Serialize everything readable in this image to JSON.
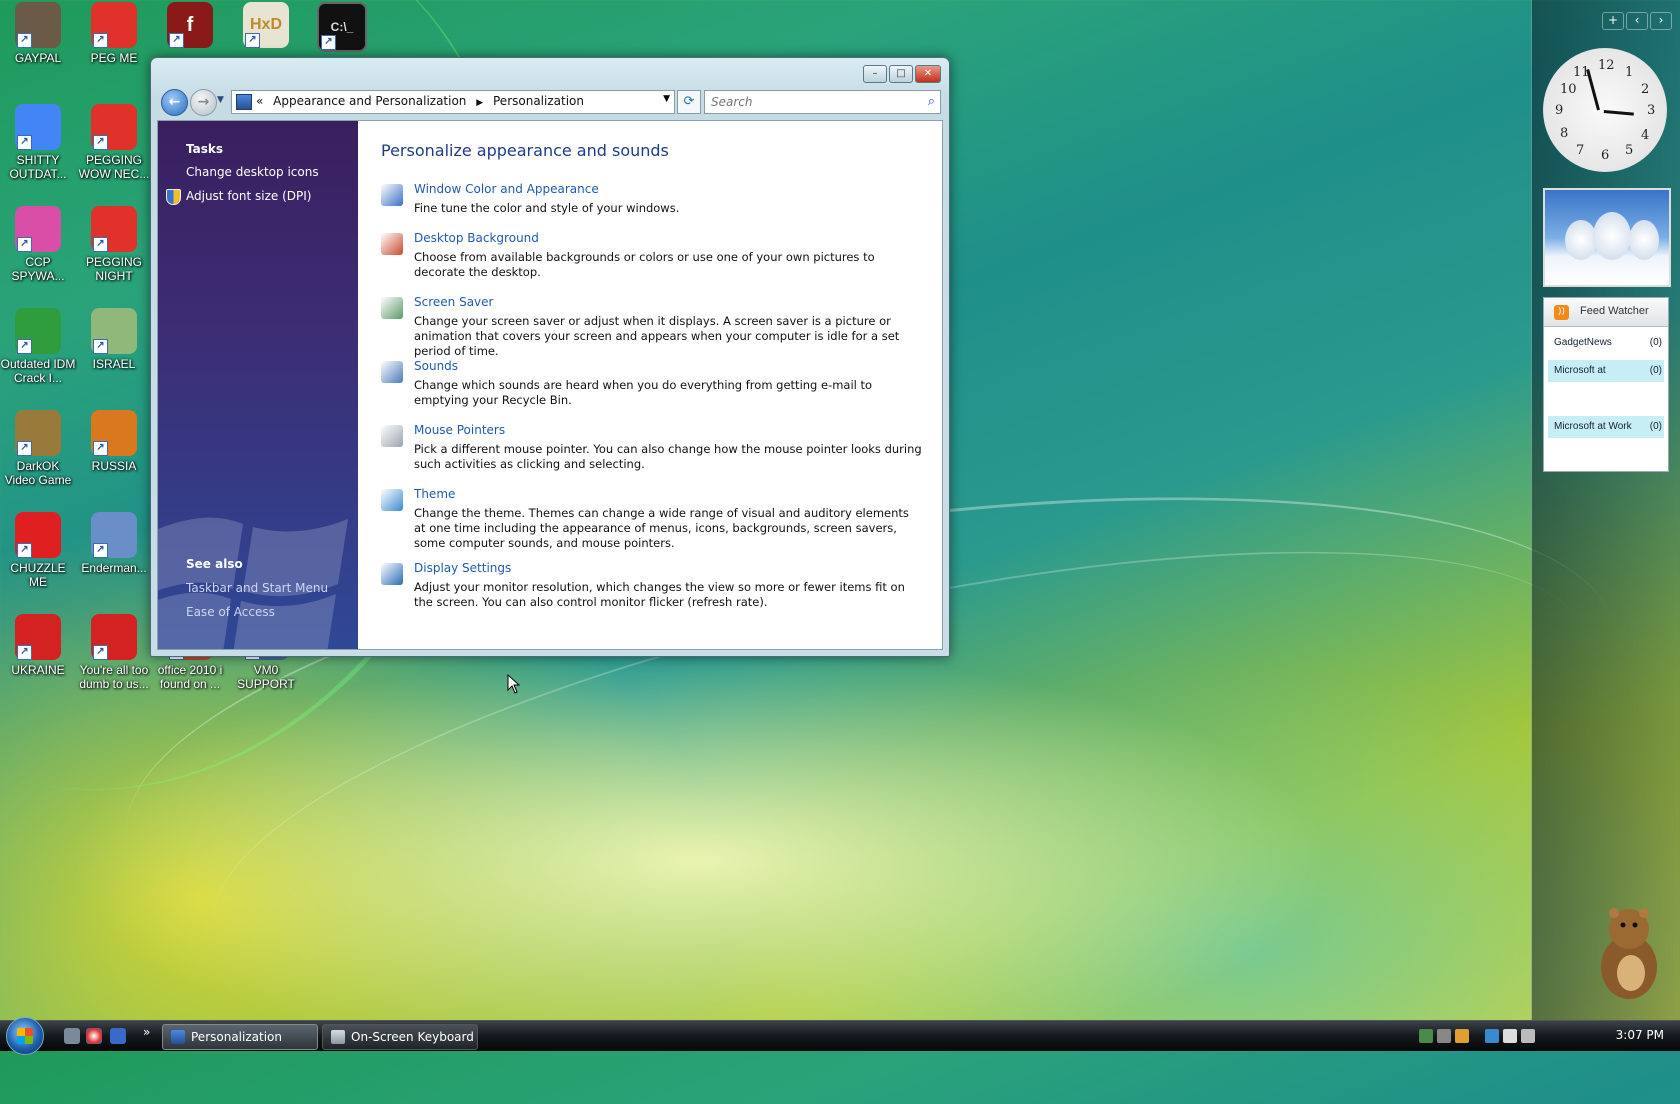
{
  "desktop": {
    "icons": [
      {
        "label": "GAYPAL",
        "color": "#6b5a45"
      },
      {
        "label": "PEG ME",
        "color": "#e0322a"
      },
      {
        "label": "SHITTY OUTDAT...",
        "color": "#4285f4"
      },
      {
        "label": "PEGGING WOW NEC...",
        "color": "#e0322a"
      },
      {
        "label": "CCP SPYWA...",
        "color": "#d94fa8"
      },
      {
        "label": "PEGGING NIGHT",
        "color": "#e0322a"
      },
      {
        "label": "Outdated IDM Crack I...",
        "color": "#2f9c3e"
      },
      {
        "label": "ISRAEL",
        "color": "#8fb87a"
      },
      {
        "label": "DarkOK Video Game",
        "color": "#9a7a3a"
      },
      {
        "label": "RUSSIA",
        "color": "#d9781e"
      },
      {
        "label": "CHUZZLE ME",
        "color": "#e02020"
      },
      {
        "label": "Enderman...",
        "color": "#6a8ec8"
      },
      {
        "label": "UKRAINE",
        "color": "#d42222"
      },
      {
        "label": "You're all too dumb to us...",
        "color": "#d42222"
      },
      {
        "label": "office 2010 i found on ...",
        "color": "#c84a2a"
      },
      {
        "label": "VM0 SUPPORT",
        "color": "#4a6a9a"
      }
    ],
    "top_icons": [
      "flash-icon",
      "hxd-icon",
      "cmd-icon"
    ]
  },
  "window": {
    "address": {
      "overflow": "«",
      "crumbs": [
        "Appearance and Personalization",
        "Personalization"
      ]
    },
    "search_placeholder": "Search",
    "left_pane": {
      "tasks_heading": "Tasks",
      "tasks": [
        "Change desktop icons",
        "Adjust font size (DPI)"
      ],
      "see_also_heading": "See also",
      "see_also": [
        "Taskbar and Start Menu",
        "Ease of Access"
      ]
    },
    "main": {
      "title": "Personalize appearance and sounds",
      "items": [
        {
          "link": "Window Color and Appearance",
          "desc": "Fine tune the color and style of your windows.",
          "color": "#3b6fc4"
        },
        {
          "link": "Desktop Background",
          "desc": "Choose from available backgrounds or colors or use one of your own pictures to decorate the desktop.",
          "color": "#c84a2a"
        },
        {
          "link": "Screen Saver",
          "desc": "Change your screen saver or adjust when it displays. A screen saver is a picture or animation that covers your screen and appears when your computer is idle for a set period of time.",
          "color": "#5a9a6a"
        },
        {
          "link": "Sounds",
          "desc": "Change which sounds are heard when you do everything from getting e-mail to emptying your Recycle Bin.",
          "color": "#4a7ab8"
        },
        {
          "link": "Mouse Pointers",
          "desc": "Pick a different mouse pointer. You can also change how the mouse pointer looks during such activities as clicking and selecting.",
          "color": "#9aa4ad"
        },
        {
          "link": "Theme",
          "desc": "Change the theme. Themes can change a wide range of visual and auditory elements at one time including the appearance of menus, icons, backgrounds, screen savers, some computer sounds, and mouse pointers.",
          "color": "#3a8ad0"
        },
        {
          "link": "Display Settings",
          "desc": "Adjust your monitor resolution, which changes the view so more or fewer items fit on the screen. You can also control monitor flicker (refresh rate).",
          "color": "#2a6ab8"
        }
      ]
    }
  },
  "sidebar": {
    "feed": {
      "title": "Feed Watcher",
      "rows": [
        {
          "name": "GadgetNews",
          "count": "(0)"
        },
        {
          "name": "Microsoft at",
          "count": "(0)"
        },
        {
          "name": "Microsoft at Work",
          "count": "(0)"
        }
      ]
    }
  },
  "taskbar": {
    "buttons": [
      "Personalization",
      "On-Screen Keyboard"
    ],
    "time": "3:07 PM"
  }
}
